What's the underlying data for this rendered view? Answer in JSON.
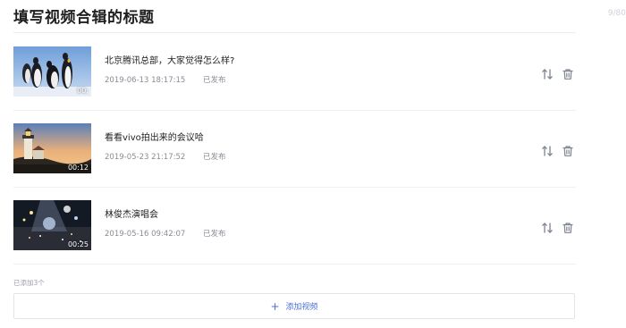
{
  "header": {
    "title": "填写视频合辑的标题",
    "char_count": "9/80"
  },
  "videos": [
    {
      "title": "北京腾讯总部，大家觉得怎么样?",
      "datetime": "2019-06-13 18:17:15",
      "status": "已发布",
      "duration": "00:",
      "thumbnail": "penguins"
    },
    {
      "title": "看看vivo拍出来的会议哈",
      "datetime": "2019-05-23 21:17:52",
      "status": "已发布",
      "duration": "00:12",
      "thumbnail": "lighthouse-sunset"
    },
    {
      "title": "林俊杰演唱会",
      "datetime": "2019-05-16 09:42:07",
      "status": "已发布",
      "duration": "00:25",
      "thumbnail": "concert"
    }
  ],
  "footer": {
    "added_count": "已添加3个",
    "add_button_label": "添加视频"
  },
  "icons": {
    "sort": "sort-icon",
    "delete": "trash-icon",
    "add": "plus-icon"
  },
  "colors": {
    "accent": "#4d6fd8",
    "meta_text": "#888c94",
    "icon": "#7d838f"
  }
}
